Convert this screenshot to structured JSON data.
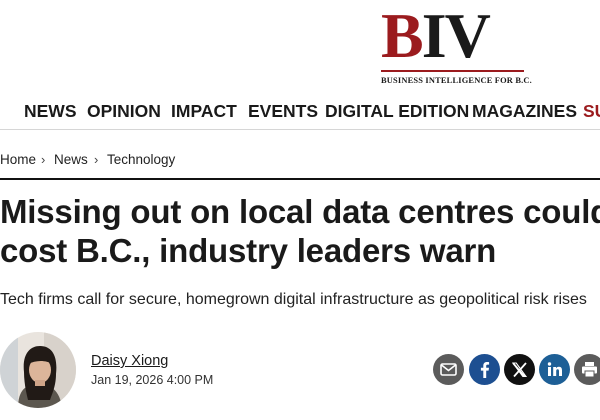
{
  "brand": {
    "logo_b": "B",
    "logo_iv": "IV",
    "tagline": "BUSINESS INTELLIGENCE FOR B.C."
  },
  "nav": {
    "items": [
      "NEWS",
      "OPINION",
      "IMPACT",
      "EVENTS",
      "DIGITAL EDITION",
      "MAGAZINES",
      "SU"
    ]
  },
  "breadcrumb": {
    "items": [
      "Home",
      "News",
      "Technology"
    ],
    "separator": "›"
  },
  "article": {
    "headline_line1": "Missing out on local data centres could",
    "headline_line2": "cost B.C., industry leaders warn",
    "subtitle": "Tech firms call for secure, homegrown digital infrastructure as geopolitical risk rises"
  },
  "author": {
    "name": "Daisy Xiong",
    "date": "Jan 19, 2026 4:00 PM"
  },
  "share": {
    "buttons": [
      "email-icon",
      "facebook-icon",
      "x-icon",
      "linkedin-icon",
      "print-icon"
    ],
    "colors": {
      "email": "#5b5b5b",
      "facebook": "#1d4f91",
      "x": "#111111",
      "linkedin": "#1d5f96",
      "print": "#5b5b5b"
    }
  },
  "colors": {
    "brand_red": "#9b1b1e",
    "text": "#1a1a1a"
  }
}
